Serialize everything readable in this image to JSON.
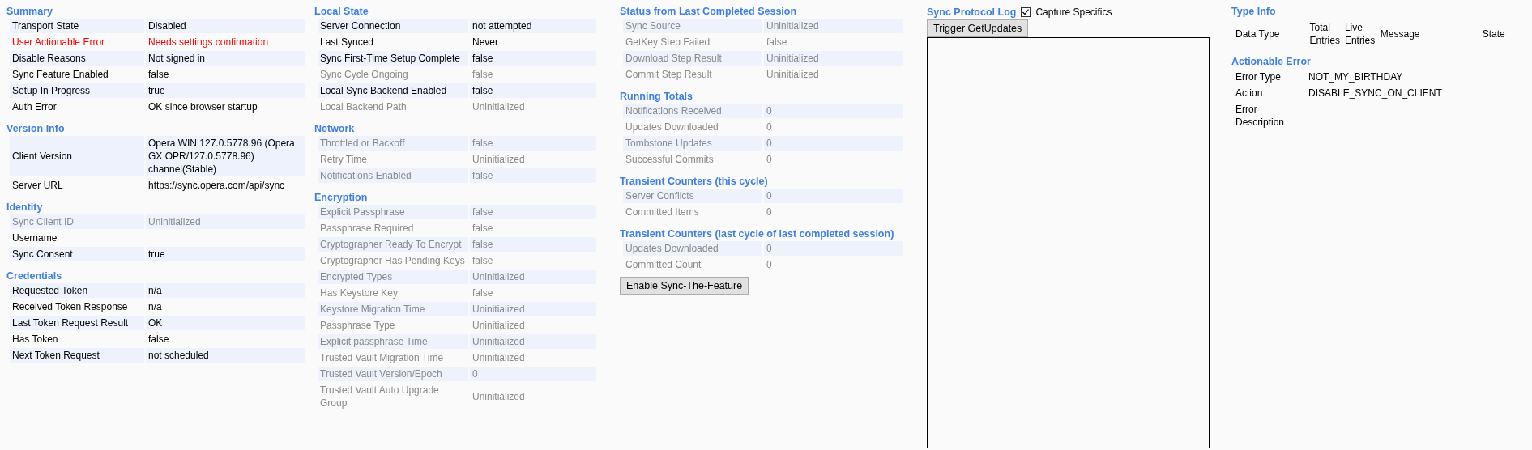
{
  "columns": [
    {
      "sections": [
        {
          "title": "Summary",
          "rows": [
            {
              "label": "Transport State",
              "value": "Disabled",
              "kind": "normal"
            },
            {
              "label": "User Actionable Error",
              "value": "Needs settings confirmation",
              "kind": "error"
            },
            {
              "label": "Disable Reasons",
              "value": "Not signed in",
              "kind": "normal"
            },
            {
              "label": "Sync Feature Enabled",
              "value": "false",
              "kind": "normal"
            },
            {
              "label": "Setup In Progress",
              "value": "true",
              "kind": "normal"
            },
            {
              "label": "Auth Error",
              "value": "OK since browser startup",
              "kind": "normal"
            }
          ]
        },
        {
          "title": "Version Info",
          "rows": [
            {
              "label": "Client Version",
              "value": "Opera WIN 127.0.5778.96 (Opera GX OPR/127.0.5778.96) channel(Stable)",
              "kind": "normal"
            },
            {
              "label": "Server URL",
              "value": "https://sync.opera.com/api/sync",
              "kind": "normal"
            }
          ]
        },
        {
          "title": "Identity",
          "rows": [
            {
              "label": "Sync Client ID",
              "value": "Uninitialized",
              "kind": "muted"
            },
            {
              "label": "Username",
              "kind": "normal"
            },
            {
              "label": "Sync Consent",
              "value": "true",
              "kind": "normal"
            }
          ]
        },
        {
          "title": "Credentials",
          "rows": [
            {
              "label": "Requested Token",
              "value": "n/a",
              "kind": "normal"
            },
            {
              "label": "Received Token Response",
              "value": "n/a",
              "kind": "normal"
            },
            {
              "label": "Last Token Request Result",
              "value": "OK",
              "kind": "normal"
            },
            {
              "label": "Has Token",
              "value": "false",
              "kind": "normal"
            },
            {
              "label": "Next Token Request",
              "value": "not scheduled",
              "kind": "normal"
            }
          ]
        }
      ]
    },
    {
      "sections": [
        {
          "title": "Local State",
          "rows": [
            {
              "label": "Server Connection",
              "value": "not attempted",
              "kind": "normal"
            },
            {
              "label": "Last Synced",
              "value": "Never",
              "kind": "normal"
            },
            {
              "label": "Sync First-Time Setup Complete",
              "value": "false",
              "kind": "normal"
            },
            {
              "label": "Sync Cycle Ongoing",
              "value": "false",
              "kind": "muted"
            },
            {
              "label": "Local Sync Backend Enabled",
              "value": "false",
              "kind": "normal"
            },
            {
              "label": "Local Backend Path",
              "value": "Uninitialized",
              "kind": "muted"
            }
          ]
        },
        {
          "title": "Network",
          "rows": [
            {
              "label": "Throttled or Backoff",
              "value": "false",
              "kind": "muted"
            },
            {
              "label": "Retry Time",
              "value": "Uninitialized",
              "kind": "muted"
            },
            {
              "label": "Notifications Enabled",
              "value": "false",
              "kind": "muted"
            }
          ]
        },
        {
          "title": "Encryption",
          "rows": [
            {
              "label": "Explicit Passphrase",
              "value": "false",
              "kind": "muted"
            },
            {
              "label": "Passphrase Required",
              "value": "false",
              "kind": "muted"
            },
            {
              "label": "Cryptographer Ready To Encrypt",
              "value": "false",
              "kind": "muted"
            },
            {
              "label": "Cryptographer Has Pending Keys",
              "value": "false",
              "kind": "muted"
            },
            {
              "label": "Encrypted Types",
              "value": "Uninitialized",
              "kind": "muted"
            },
            {
              "label": "Has Keystore Key",
              "value": "false",
              "kind": "muted"
            },
            {
              "label": "Keystore Migration Time",
              "value": "Uninitialized",
              "kind": "muted"
            },
            {
              "label": "Passphrase Type",
              "value": "Uninitialized",
              "kind": "muted"
            },
            {
              "label": "Explicit passphrase Time",
              "value": "Uninitialized",
              "kind": "muted"
            },
            {
              "label": "Trusted Vault Migration Time",
              "value": "Uninitialized",
              "kind": "muted"
            },
            {
              "label": "Trusted Vault Version/Epoch",
              "value": "0",
              "kind": "muted"
            },
            {
              "label": "Trusted Vault Auto Upgrade Group",
              "value": "Uninitialized",
              "kind": "muted"
            }
          ]
        }
      ]
    },
    {
      "sections": [
        {
          "title": "Status from Last Completed Session",
          "rows": [
            {
              "label": "Sync Source",
              "value": "Uninitialized",
              "kind": "muted"
            },
            {
              "label": "GetKey Step Failed",
              "value": "false",
              "kind": "muted"
            },
            {
              "label": "Download Step Result",
              "value": "Uninitialized",
              "kind": "muted"
            },
            {
              "label": "Commit Step Result",
              "value": "Uninitialized",
              "kind": "muted"
            }
          ]
        },
        {
          "title": "Running Totals",
          "rows": [
            {
              "label": "Notifications Received",
              "value": "0",
              "kind": "muted"
            },
            {
              "label": "Updates Downloaded",
              "value": "0",
              "kind": "muted"
            },
            {
              "label": "Tombstone Updates",
              "value": "0",
              "kind": "muted"
            },
            {
              "label": "Successful Commits",
              "value": "0",
              "kind": "muted"
            }
          ]
        },
        {
          "title": "Transient Counters (this cycle)",
          "rows": [
            {
              "label": "Server Conflicts",
              "value": "0",
              "kind": "muted"
            },
            {
              "label": "Committed Items",
              "value": "0",
              "kind": "muted"
            }
          ]
        },
        {
          "title": "Transient Counters (last cycle of last completed session)",
          "rows": [
            {
              "label": "Updates Downloaded",
              "value": "0",
              "kind": "muted"
            },
            {
              "label": "Committed Count",
              "value": "0",
              "kind": "muted"
            }
          ]
        }
      ],
      "button": {
        "label": "Enable Sync-The-Feature"
      }
    }
  ],
  "sync_protocol_log": {
    "title": "Sync Protocol Log",
    "capture_specifics": {
      "label": "Capture Specifics",
      "checked": true
    },
    "button": {
      "label": "Trigger GetUpdates"
    }
  },
  "type_info": {
    "title": "Type Info",
    "columns": [
      "Data Type",
      "Total Entries",
      "Live Entries",
      "Message",
      "State"
    ]
  },
  "actionable_error": {
    "title": "Actionable Error",
    "rows": [
      {
        "label": "Error Type",
        "value": "NOT_MY_BIRTHDAY"
      },
      {
        "label": "Action",
        "value": "DISABLE_SYNC_ON_CLIENT"
      },
      {
        "label": "Error Description"
      }
    ]
  }
}
